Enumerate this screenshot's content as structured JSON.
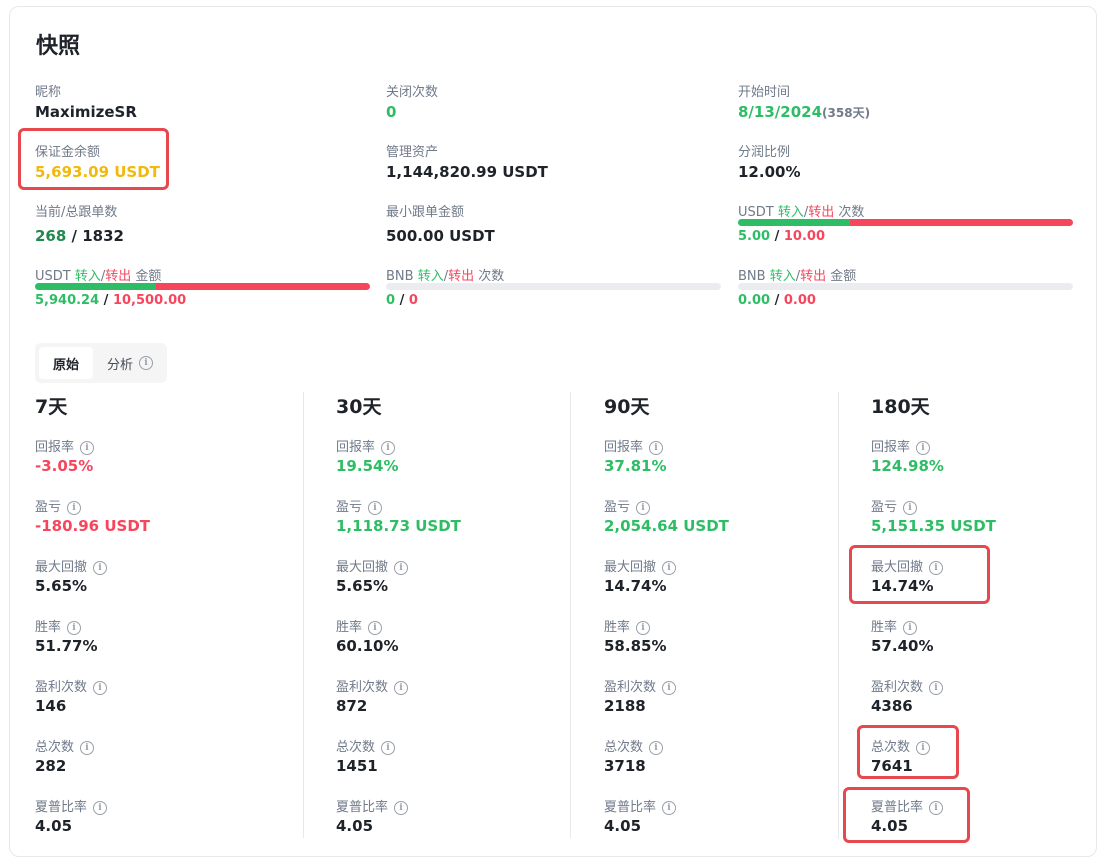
{
  "title": "快照",
  "overview": {
    "nickname": {
      "label": "昵称",
      "value": "MaximizeSR"
    },
    "close_count": {
      "label": "关闭次数",
      "value": "0"
    },
    "start_time": {
      "label": "开始时间",
      "value": "8/13/2024",
      "days": "(358天)"
    },
    "margin_balance": {
      "label": "保证金余额",
      "value": "5,693.09 USDT"
    },
    "aum": {
      "label": "管理资产",
      "value": "1,144,820.99 USDT"
    },
    "profit_share": {
      "label": "分润比例",
      "value": "12.00%"
    },
    "copiers": {
      "label": "当前/总跟单数",
      "current": "268",
      "separator": " / ",
      "total": "1832"
    },
    "min_copy": {
      "label": "最小跟单金额",
      "value": "500.00 USDT"
    },
    "usdt_count": {
      "prefix": "USDT",
      "in": "转入",
      "slash": "/",
      "out": "转出",
      "suffix": "次数",
      "in_value": "5.00",
      "out_value": "10.00",
      "sep": " / ",
      "in_fraction": 0.333
    },
    "usdt_amount": {
      "prefix": "USDT",
      "in": "转入",
      "slash": "/",
      "out": "转出",
      "suffix": "金额",
      "in_value": "5,940.24",
      "out_value": "10,500.00",
      "sep": " / ",
      "in_fraction": 0.361
    },
    "bnb_count": {
      "prefix": "BNB",
      "in": "转入",
      "slash": "/",
      "out": "转出",
      "suffix": "次数",
      "in_value": "0",
      "out_value": "0",
      "sep": " / ",
      "in_fraction": 0
    },
    "bnb_amount": {
      "prefix": "BNB",
      "in": "转入",
      "slash": "/",
      "out": "转出",
      "suffix": "金额",
      "in_value": "0.00",
      "out_value": "0.00",
      "sep": " / ",
      "in_fraction": 0
    }
  },
  "tabs": {
    "raw": "原始",
    "analysis": "分析",
    "info_glyph": "i"
  },
  "metric_labels": {
    "roi": "回报率",
    "pnl": "盈亏",
    "mdd": "最大回撤",
    "win_rate": "胜率",
    "win_count": "盈利次数",
    "total_count": "总次数",
    "sharpe": "夏普比率"
  },
  "periods": [
    {
      "title": "7天",
      "roi": "-3.05%",
      "pnl": "-180.96 USDT",
      "mdd": "5.65%",
      "win_rate": "51.77%",
      "win_count": "146",
      "total_count": "282",
      "sharpe": "4.05"
    },
    {
      "title": "30天",
      "roi": "19.54%",
      "pnl": "1,118.73 USDT",
      "mdd": "5.65%",
      "win_rate": "60.10%",
      "win_count": "872",
      "total_count": "1451",
      "sharpe": "4.05"
    },
    {
      "title": "90天",
      "roi": "37.81%",
      "pnl": "2,054.64 USDT",
      "mdd": "14.74%",
      "win_rate": "58.85%",
      "win_count": "2188",
      "total_count": "3718",
      "sharpe": "4.05"
    },
    {
      "title": "180天",
      "roi": "124.98%",
      "pnl": "5,151.35 USDT",
      "mdd": "14.74%",
      "win_rate": "57.40%",
      "win_count": "4386",
      "total_count": "7641",
      "sharpe": "4.05"
    }
  ],
  "colors": {
    "positive": "#2ebd65",
    "negative": "#f6465d",
    "highlight": "#e6484e",
    "balance": "#f0b90b"
  }
}
